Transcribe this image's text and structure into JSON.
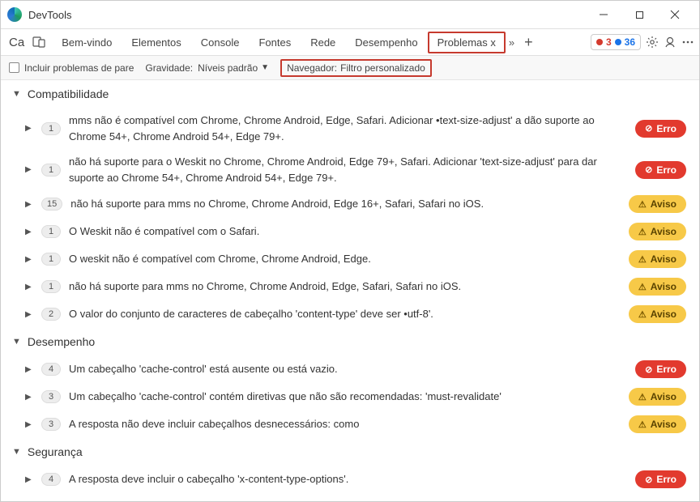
{
  "window": {
    "title": "DevTools"
  },
  "toolbar_left": {
    "ca": "Ca"
  },
  "tabs": {
    "0": "Bem-vindo",
    "1": "Elementos",
    "2": "Console",
    "3": "Fontes",
    "4": "Rede",
    "5": "Desempenho",
    "6": "Problemas x"
  },
  "counters": {
    "errors": "3",
    "info": "36"
  },
  "filters": {
    "include": "Incluir problemas de pare",
    "severity_label": "Gravidade:",
    "severity_value": "Níveis padrão",
    "browser_label": "Navegador:",
    "browser_value": "Filtro personalizado"
  },
  "sections": {
    "compat": "Compatibilidade",
    "perf": "Desempenho",
    "sec": "Segurança"
  },
  "badges": {
    "error": "Erro",
    "warning": "Aviso"
  },
  "compat_items": {
    "0": {
      "count": "1",
      "text": "mms não é compatível com Chrome, Chrome Android, Edge, Safari. Adicionar •text-size-adjust' a dão suporte ao Chrome 54+, Chrome Android 54+, Edge 79+."
    },
    "1": {
      "count": "1",
      "text": "não há suporte para o Weskit no Chrome, Chrome Android, Edge 79+, Safari. Adicionar 'text-size-adjust' para dar suporte ao Chrome 54+, Chrome Android 54+, Edge 79+."
    },
    "2": {
      "count": "15",
      "text": "não há suporte para mms no Chrome, Chrome Android, Edge 16+, Safari, Safari no iOS."
    },
    "3": {
      "count": "1",
      "text": "O Weskit não é compatível com o Safari."
    },
    "4": {
      "count": "1",
      "text": "O weskit não é compatível com Chrome, Chrome Android, Edge."
    },
    "5": {
      "count": "1",
      "text": "não há suporte para mms no Chrome, Chrome Android, Edge, Safari, Safari no iOS."
    },
    "6": {
      "count": "2",
      "text": "O valor do conjunto de caracteres de cabeçalho 'content-type' deve ser •utf-8'."
    }
  },
  "perf_items": {
    "0": {
      "count": "4",
      "text": "Um cabeçalho 'cache-control' está ausente ou está vazio."
    },
    "1": {
      "count": "3",
      "text": "Um cabeçalho 'cache-control' contém diretivas que não são recomendadas: 'must-revalidate'"
    },
    "2": {
      "count": "3",
      "text": "A resposta não deve incluir cabeçalhos desnecessários: como"
    }
  },
  "sec_items": {
    "0": {
      "count": "4",
      "text": "A resposta deve incluir o cabeçalho 'x-content-type-options'."
    }
  }
}
